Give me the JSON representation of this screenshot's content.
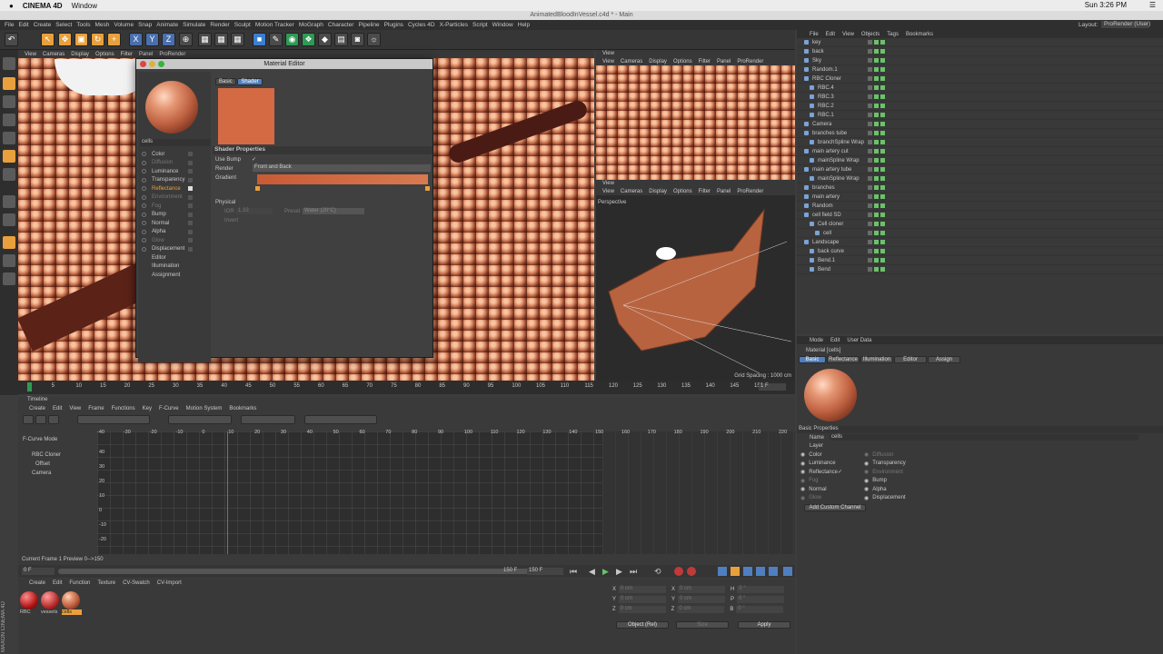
{
  "macbar": {
    "app": "CINEMA 4D",
    "window_menu": "Window",
    "time": "Sun 3:26 PM"
  },
  "titlebar": "AnimatedBloodInVessel.c4d * - Main",
  "menu": [
    "File",
    "Edit",
    "Create",
    "Select",
    "Tools",
    "Mesh",
    "Volume",
    "Snap",
    "Animate",
    "Simulate",
    "Render",
    "Sculpt",
    "Motion Tracker",
    "MoGraph",
    "Character",
    "Pipeline",
    "Plugins",
    "Cycles 4D",
    "X-Particles",
    "Script",
    "Window",
    "Help"
  ],
  "layout": "Layout:",
  "layout_value": "ProRender (User)",
  "toolbar": {
    "x": "X",
    "y": "Y",
    "z": "Z"
  },
  "viewport_menu": [
    "View",
    "Cameras",
    "Display",
    "Options",
    "Filter",
    "Panel",
    "ProRender"
  ],
  "material_editor": {
    "title": "Material Editor",
    "material_name": "cells",
    "tabs": [
      "Basic",
      "Shader"
    ],
    "channels": [
      "Color",
      "Diffusion",
      "Luminance",
      "Transparency",
      "Reflectance",
      "Environment",
      "Fog",
      "Bump",
      "Normal",
      "Alpha",
      "Glow",
      "Displacement",
      "Editor",
      "Illumination",
      "Assignment"
    ],
    "shader_header": "Shader Properties",
    "use_bump": "Use Bump",
    "render": "Render",
    "render_value": "Front and Back",
    "gradient": "Gradient",
    "physical": "Physical",
    "ior": "IOR",
    "ior_value": "1.33",
    "preset": "Preset",
    "preset_value": "Water (20°C)",
    "invert": "Invert"
  },
  "viewport_right_top": {
    "label": "View",
    "menu": [
      "View",
      "Cameras",
      "Display",
      "Options",
      "Filter",
      "Panel",
      "ProRender"
    ]
  },
  "viewport_right_bottom": {
    "label": "View",
    "menu": [
      "View",
      "Cameras",
      "Display",
      "Options",
      "Filter",
      "Panel",
      "ProRender"
    ],
    "perspective": "Perspective",
    "grid": "Grid Spacing : 1000 cm"
  },
  "object_manager": {
    "menu": [
      "File",
      "Edit",
      "View",
      "Objects",
      "Tags",
      "Bookmarks"
    ],
    "objects": [
      "key",
      "back",
      "Sky",
      "Random.1",
      "RBC Cloner",
      "RBC.4",
      "RBC.3",
      "RBC.2",
      "RBC.1",
      "Camera",
      "branches tube",
      "branchSpline Wrap",
      "main artery cut",
      "mainSpline Wrap",
      "main artery tube",
      "mainSpline Wrap",
      "branches",
      "main artery",
      "Random",
      "cell field SD",
      "Cell cloner",
      "cell",
      "Landscape",
      "back curve",
      "Bend.1",
      "Bend"
    ]
  },
  "attributes": {
    "menu": [
      "Mode",
      "Edit",
      "User Data"
    ],
    "material_label": "Material [cells]",
    "tabs": [
      "Basic",
      "Reflectance",
      "Illumination",
      "Editor",
      "Assign"
    ],
    "section": "Basic Properties",
    "name_label": "Name",
    "name_value": "cells",
    "layer_label": "Layer",
    "left": [
      "Color",
      "Luminance",
      "Reflectance",
      "Fog",
      "Normal",
      "Glow"
    ],
    "right": [
      "Diffusion",
      "Transparency",
      "Environment",
      "Bump",
      "Alpha",
      "Displacement"
    ],
    "add_custom": "Add Custom Channel"
  },
  "timeline": {
    "ticks": [
      "0",
      "5",
      "10",
      "15",
      "20",
      "25",
      "30",
      "35",
      "40",
      "45",
      "50",
      "55",
      "60",
      "65",
      "70",
      "75",
      "80",
      "85",
      "90",
      "95",
      "100",
      "105",
      "110",
      "115",
      "120",
      "125",
      "130",
      "135",
      "140",
      "145",
      "150"
    ],
    "frame": "1 F"
  },
  "fcurve": {
    "title": "Timeline",
    "menu": [
      "Create",
      "Edit",
      "View",
      "Frame",
      "Functions",
      "Key",
      "F-Curve",
      "Motion System",
      "Bookmarks"
    ],
    "mode": "F-Curve Mode",
    "tracks": [
      "RBC Cloner",
      "Offset",
      "Camera"
    ],
    "ticks": [
      "-40",
      "-30",
      "-20",
      "-10",
      "0",
      "10",
      "20",
      "30",
      "40",
      "50",
      "60",
      "70",
      "80",
      "90",
      "100",
      "110",
      "120",
      "130",
      "140",
      "150",
      "160",
      "170",
      "180",
      "190",
      "200",
      "210",
      "220"
    ],
    "yticks": [
      "40",
      "30",
      "20",
      "10",
      "0",
      "-10",
      "-20"
    ],
    "status": "Current Frame 1  Preview 0-->150",
    "start": "0 F",
    "end": "150 F",
    "end2": "150 F"
  },
  "material_manager": {
    "menu": [
      "Create",
      "Edit",
      "Function",
      "Texture",
      "CV-Swatch",
      "CV-Import"
    ],
    "materials": [
      "RBC",
      "vessels",
      "cells"
    ]
  },
  "coords": {
    "rows": [
      [
        "X",
        "0 cm",
        "X",
        "0 cm",
        "H",
        "0 °"
      ],
      [
        "Y",
        "0 cm",
        "Y",
        "0 cm",
        "P",
        "0 °"
      ],
      [
        "Z",
        "0 cm",
        "Z",
        "0 cm",
        "B",
        "0 °"
      ]
    ],
    "mode": "Object (Rel)",
    "size": "Size",
    "apply": "Apply"
  },
  "logo": "MAXON CINEMA 4D",
  "colors": {
    "accent": "#4f7fbf",
    "material": "#d46a44",
    "highlight": "#e9a03c"
  }
}
